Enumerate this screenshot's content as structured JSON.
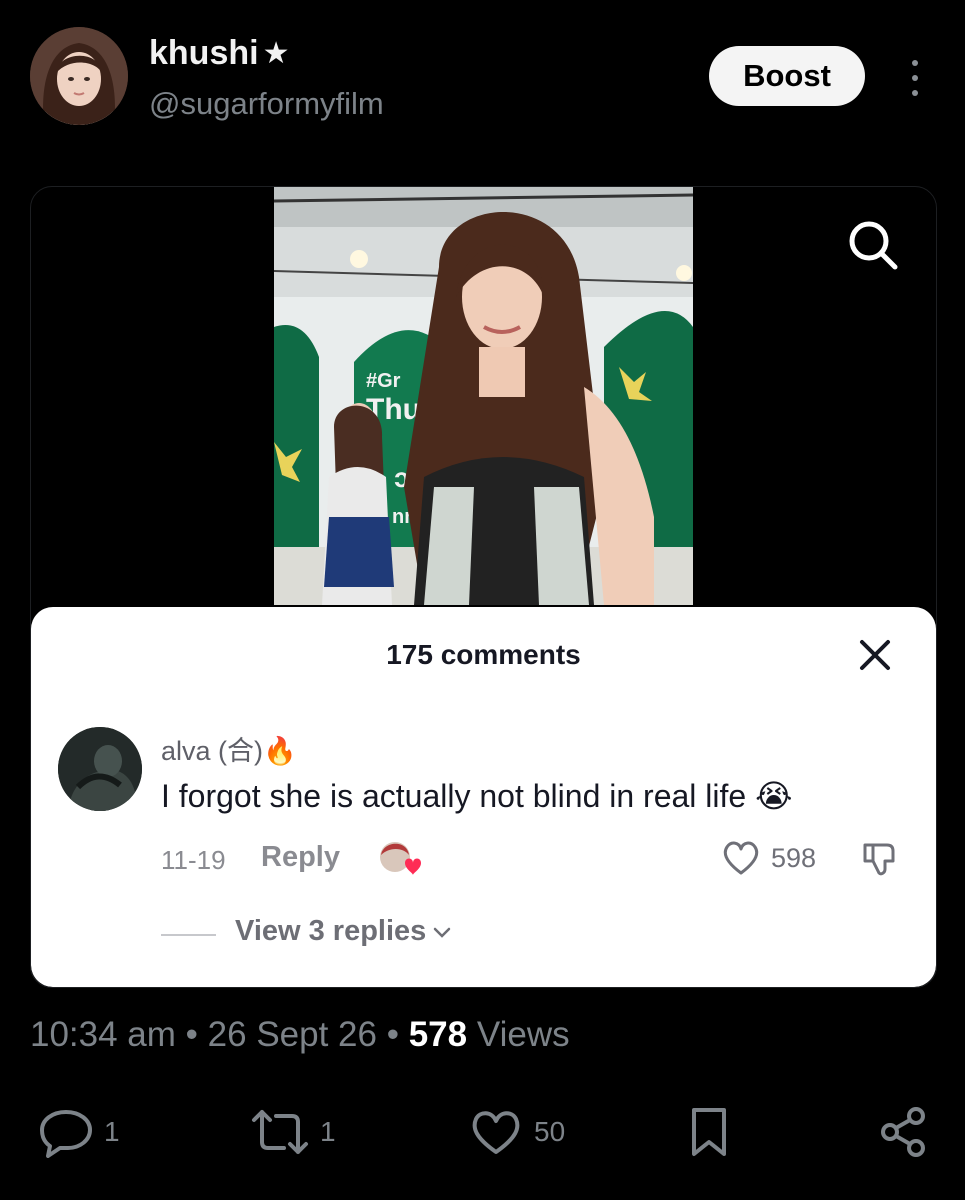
{
  "post": {
    "display_name": "khushi",
    "badge": "★",
    "handle": "@sugarformyfilm",
    "boost_label": "Boost",
    "time": "10:34 am",
    "date": "26 Sept 26",
    "views_count": "578",
    "views_label": "Views",
    "separator": "•"
  },
  "media": {
    "icons": {
      "search": "search-icon"
    },
    "video_text": [
      "#Gr",
      "Thu",
      "ɔsi",
      "nr"
    ]
  },
  "comments_sheet": {
    "title": "175 comments",
    "comment": {
      "username": "alva (合)🔥",
      "text": "I forgot she is actually not blind in real life 😭",
      "date": "11-19",
      "reply_label": "Reply",
      "likes": "598",
      "view_replies": "View 3 replies"
    }
  },
  "actions": {
    "replies": "1",
    "reposts": "1",
    "likes": "50"
  },
  "colors": {
    "background": "#000000",
    "muted": "#7d8389",
    "sheet": "#ffffff"
  }
}
